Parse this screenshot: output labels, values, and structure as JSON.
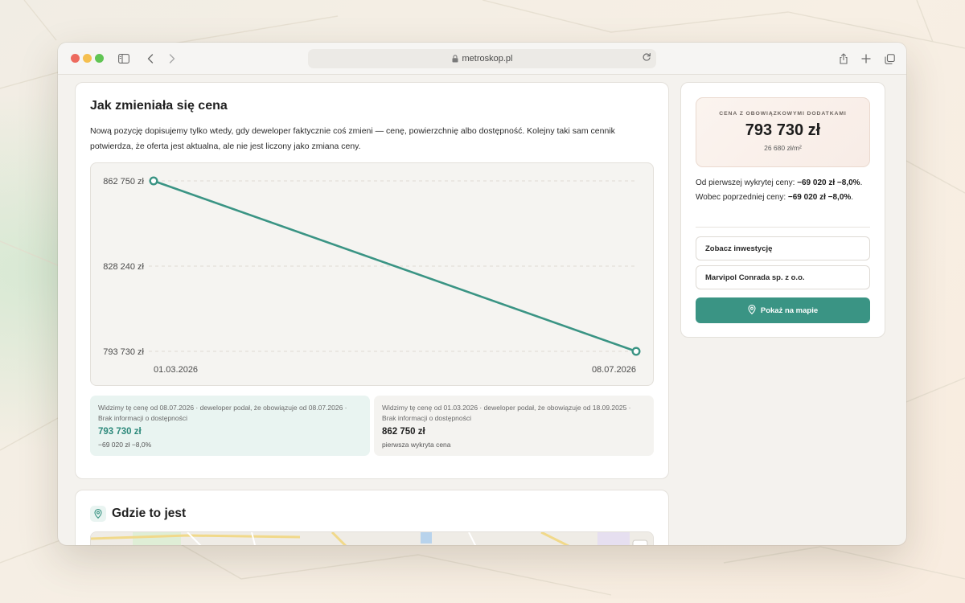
{
  "browser": {
    "url": "metroskop.pl"
  },
  "price_history": {
    "title": "Jak zmieniała się cena",
    "description": "Nową pozycję dopisujemy tylko wtedy, gdy deweloper faktycznie coś zmieni — cenę, powierzchnię albo dostępność. Kolejny taki sam cennik potwierdza, że oferta jest aktualna, ale nie jest liczony jako zmiana ceny.",
    "entries": [
      {
        "meta": "Widzimy tę cenę od 08.07.2026 · deweloper podał, że obowiązuje od 08.07.2026 · Brak informacji o dostępności",
        "price": "793 730 zł",
        "sub": "−69 020 zł −8,0%"
      },
      {
        "meta": "Widzimy tę cenę od 01.03.2026 · deweloper podał, że obowiązuje od 18.09.2025 · Brak informacji o dostępności",
        "price": "862 750 zł",
        "sub": "pierwsza wykryta cena"
      }
    ]
  },
  "chart_data": {
    "type": "line",
    "x": [
      "01.03.2026",
      "08.07.2026"
    ],
    "series": [
      {
        "values": [
          862750,
          793730
        ]
      }
    ],
    "y_ticks": [
      862750,
      828240,
      793730
    ],
    "y_tick_labels": [
      "862 750 zł",
      "828 240 zł",
      "793 730 zł"
    ],
    "ylim": [
      793730,
      862750
    ],
    "grid": true,
    "color": "#3a9484"
  },
  "side": {
    "price_label": "CENA Z OBOWIĄZKOWYMI DODATKAMI",
    "price": "793 730 zł",
    "price_per_m2": "26 680 zł/m²",
    "change_prefix1": "Od pierwszej wykrytej ceny: ",
    "change_value1": "−69 020 zł −8,0%",
    "change_prefix2": ". Wobec poprzedniej ceny: ",
    "change_value2": "−69 020 zł −8,0%",
    "change_suffix": ".",
    "button_investment": "Zobacz inwestycję",
    "button_developer": "Marvipol Conrada sp. z o.o.",
    "button_map": "Pokaż na mapie"
  },
  "location": {
    "title": "Gdzie to jest"
  },
  "colors": {
    "accent": "#3a9484",
    "accent_light": "#e9f4f1"
  }
}
